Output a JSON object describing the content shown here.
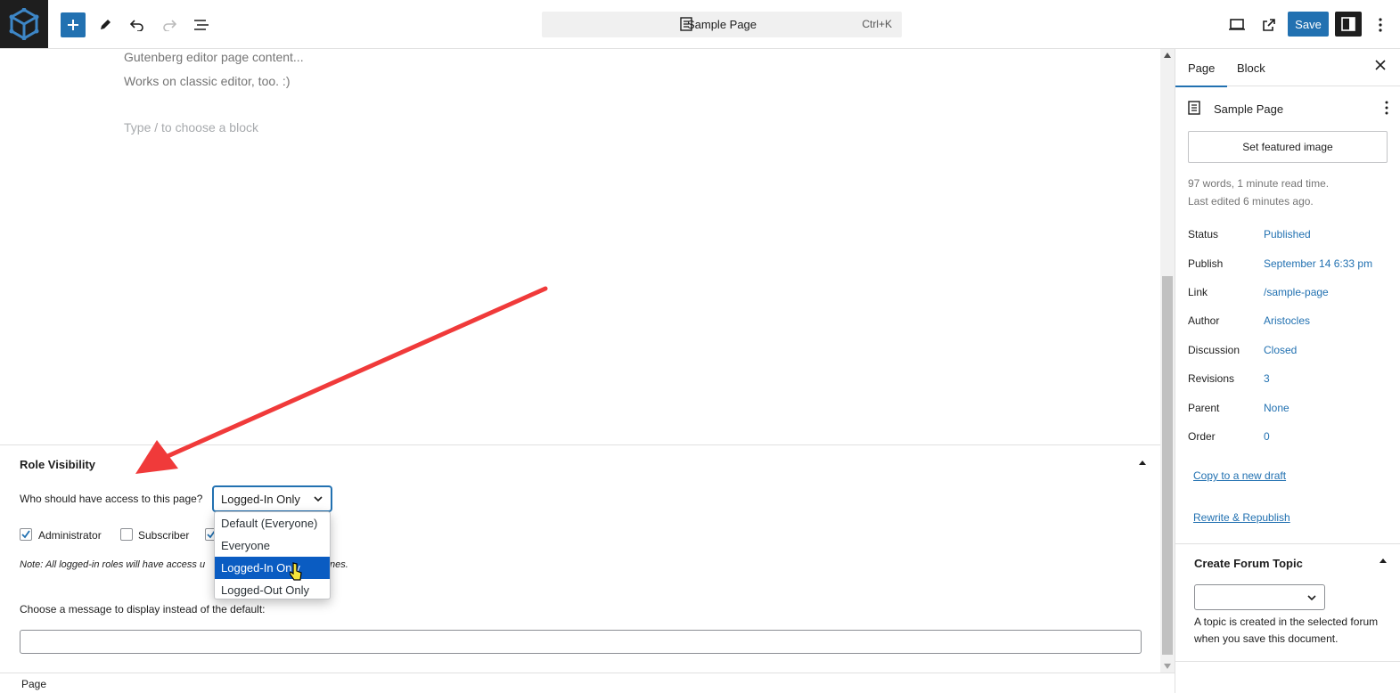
{
  "topbar": {
    "document_title": "Sample Page",
    "shortcut": "Ctrl+K",
    "save_label": "Save",
    "icons": [
      "site-logo-icon",
      "plus-icon",
      "pencil-icon",
      "undo-icon",
      "redo-icon",
      "list-view-icon",
      "desktop-preview-icon",
      "external-view-icon",
      "sidebar-toggle-icon",
      "options-icon"
    ]
  },
  "canvas": {
    "line1": "Gutenberg editor page content...",
    "line2": "Works on classic editor, too. :)",
    "placeholder": "Type / to choose a block"
  },
  "role_visibility": {
    "title": "Role Visibility",
    "question": "Who should have access to this page?",
    "selected": "Logged-In Only",
    "options": [
      "Default (Everyone)",
      "Everyone",
      "Logged-In Only",
      "Logged-Out Only"
    ],
    "roles": [
      {
        "label": "Administrator",
        "checked": true
      },
      {
        "label": "Subscriber",
        "checked": false
      }
    ],
    "note_start": "Note: All logged-in roles will have access u",
    "note_end": "nes.",
    "message_label": "Choose a message to display instead of the default:",
    "message_value": ""
  },
  "footer": {
    "breadcrumb": "Page"
  },
  "sidebar": {
    "tabs": [
      "Page",
      "Block"
    ],
    "doc_name": "Sample Page",
    "featured_image": "Set featured image",
    "words": "97 words, 1 minute read time.",
    "edited": "Last edited 6 minutes ago.",
    "summary": [
      {
        "key": "Status",
        "value": "Published"
      },
      {
        "key": "Publish",
        "value": "September 14 6:33 pm"
      },
      {
        "key": "Link",
        "value": "/sample-page"
      },
      {
        "key": "Author",
        "value": "Aristocles"
      },
      {
        "key": "Discussion",
        "value": "Closed"
      },
      {
        "key": "Revisions",
        "value": "3"
      },
      {
        "key": "Parent",
        "value": "None"
      },
      {
        "key": "Order",
        "value": "0"
      }
    ],
    "copy_draft": "Copy to a new draft",
    "rewrite": "Rewrite & Republish",
    "forum": {
      "title": "Create Forum Topic",
      "help": "A topic is created in the selected forum when you save this document."
    }
  },
  "colors": {
    "accent": "#2271b1",
    "arrow": "#f03a3a",
    "selected_option": "#0a5cc2"
  }
}
